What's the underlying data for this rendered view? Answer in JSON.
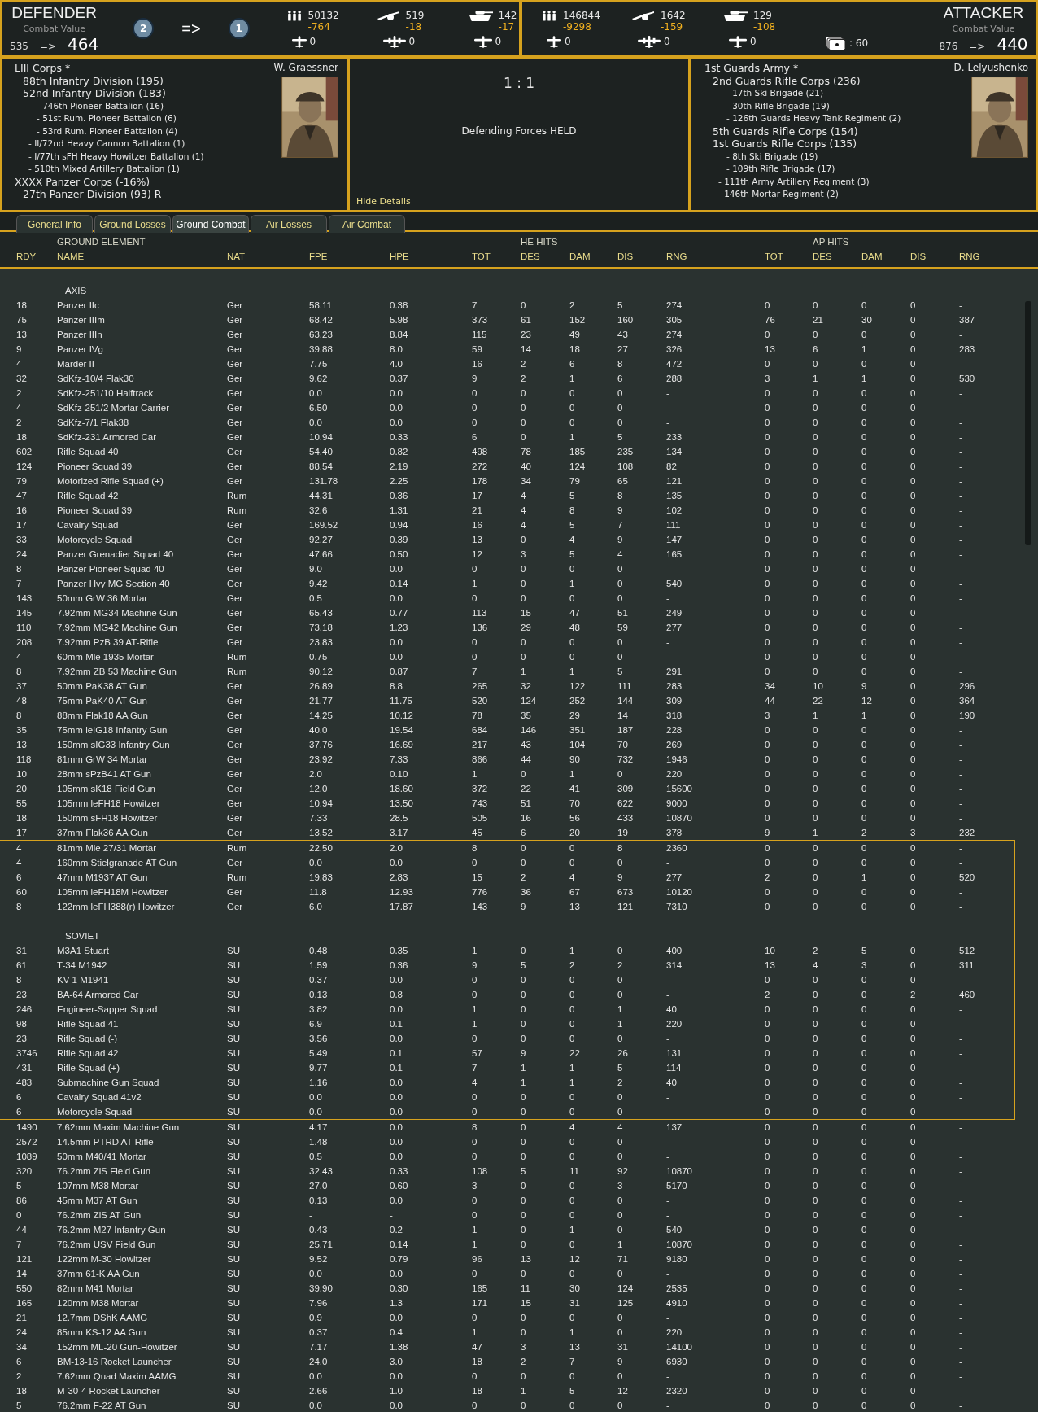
{
  "defender": {
    "title": "DEFENDER",
    "cv_label": "Combat Value",
    "cv_before": "535",
    "cv_arrow": "=>",
    "cv_after": "464",
    "markers": [
      "2",
      "1"
    ],
    "marker_arrow": "=>",
    "stats": [
      {
        "kind": "infantry",
        "value": "50132",
        "delta": "-764"
      },
      {
        "kind": "gun",
        "value": "519",
        "delta": "-18"
      },
      {
        "kind": "tank",
        "value": "142",
        "delta": "-17"
      }
    ],
    "air": [
      {
        "kind": "fighter",
        "value": "0"
      },
      {
        "kind": "bomber",
        "value": "0"
      },
      {
        "kind": "transport",
        "value": "0"
      }
    ]
  },
  "attacker": {
    "title": "ATTACKER",
    "cv_label": "Combat Value",
    "cv_before": "876",
    "cv_arrow": "=>",
    "cv_after": "440",
    "cards": ": 60",
    "stats": [
      {
        "kind": "infantry",
        "value": "146844",
        "delta": "-9298"
      },
      {
        "kind": "gun",
        "value": "1642",
        "delta": "-159"
      },
      {
        "kind": "tank",
        "value": "129",
        "delta": "-108"
      }
    ],
    "air": [
      {
        "kind": "fighter",
        "value": "0"
      },
      {
        "kind": "bomber",
        "value": "0"
      },
      {
        "kind": "transport",
        "value": "0"
      }
    ]
  },
  "defender_oob": {
    "leader": "W. Graessner",
    "units": [
      {
        "label": "LIII Corps *",
        "kind": "formation",
        "children": [
          {
            "label": "88th Infantry Division (195)",
            "kind": "formation"
          },
          {
            "label": "52nd Infantry Division (183)",
            "kind": "formation",
            "children": [
              {
                "label": "- 746th Pioneer Battalion (16)",
                "kind": "attachment"
              },
              {
                "label": "- 51st Rum. Pioneer Battalion (6)",
                "kind": "attachment"
              },
              {
                "label": "- 53rd Rum. Pioneer Battalion (4)",
                "kind": "attachment"
              }
            ]
          },
          {
            "label": "- II/72nd Heavy Cannon Battalion (1)",
            "kind": "attachment"
          },
          {
            "label": "- I/77th sFH Heavy Howitzer Battalion (1)",
            "kind": "attachment"
          },
          {
            "label": "- 510th Mixed Artillery Battalion (1)",
            "kind": "attachment"
          }
        ]
      },
      {
        "label": "XXXX Panzer Corps (-16%)",
        "kind": "formation",
        "children": [
          {
            "label": "27th Panzer Division (93)  R",
            "kind": "formation"
          }
        ]
      }
    ]
  },
  "result": {
    "odds": "1 : 1",
    "outcome": "Defending Forces HELD",
    "hide_link": "Hide Details"
  },
  "attacker_oob": {
    "leader": "D. Lelyushenko",
    "units": [
      {
        "label": "1st Guards Army *",
        "kind": "formation",
        "children": [
          {
            "label": "2nd Guards Rifle Corps (236)",
            "kind": "formation",
            "children": [
              {
                "label": "- 17th Ski Brigade (21)",
                "kind": "attachment"
              },
              {
                "label": "- 30th Rifle Brigade (19)",
                "kind": "attachment"
              },
              {
                "label": "- 126th Guards Heavy Tank Regiment (2)",
                "kind": "attachment"
              }
            ]
          },
          {
            "label": "5th Guards Rifle Corps (154)",
            "kind": "formation"
          },
          {
            "label": "1st Guards Rifle Corps (135)",
            "kind": "formation",
            "children": [
              {
                "label": "- 8th Ski Brigade (19)",
                "kind": "attachment"
              },
              {
                "label": "- 109th Rifle Brigade (17)",
                "kind": "attachment"
              }
            ]
          },
          {
            "label": "- 111th Army Artillery Regiment (3)",
            "kind": "attachment"
          },
          {
            "label": "- 146th Mortar Regiment (2)",
            "kind": "attachment"
          }
        ]
      }
    ]
  },
  "tabs": [
    {
      "label": "General Info",
      "selected": false
    },
    {
      "label": "Ground Losses",
      "selected": false
    },
    {
      "label": "Ground Combat",
      "selected": true
    },
    {
      "label": "Air Losses",
      "selected": false
    },
    {
      "label": "Air Combat",
      "selected": false
    }
  ],
  "table": {
    "group_headers": [
      "GROUND ELEMENT",
      "HE HITS",
      "AP HITS"
    ],
    "columns": [
      "RDY",
      "NAME",
      "NAT",
      "FPE",
      "HPE",
      "TOT",
      "DES",
      "DAM",
      "DIS",
      "RNG",
      "TOT",
      "DES",
      "DAM",
      "DIS",
      "RNG"
    ],
    "blocks": [
      {
        "framed": false,
        "rows": [
          {
            "kind": "blank"
          },
          {
            "kind": "section",
            "label": "AXIS"
          },
          {
            "kind": "unit",
            "cells": [
              "18",
              "Panzer IIc",
              "Ger",
              "58.11",
              "0.38",
              "7",
              "0",
              "2",
              "5",
              "274",
              "0",
              "0",
              "0",
              "0",
              "-"
            ]
          },
          {
            "kind": "unit",
            "cells": [
              "75",
              "Panzer IIIm",
              "Ger",
              "68.42",
              "5.98",
              "373",
              "61",
              "152",
              "160",
              "305",
              "76",
              "21",
              "30",
              "0",
              "387"
            ]
          },
          {
            "kind": "unit",
            "cells": [
              "13",
              "Panzer IIIn",
              "Ger",
              "63.23",
              "8.84",
              "115",
              "23",
              "49",
              "43",
              "274",
              "0",
              "0",
              "0",
              "0",
              "-"
            ]
          },
          {
            "kind": "unit",
            "cells": [
              "9",
              "Panzer IVg",
              "Ger",
              "39.88",
              "8.0",
              "59",
              "14",
              "18",
              "27",
              "326",
              "13",
              "6",
              "1",
              "0",
              "283"
            ]
          },
          {
            "kind": "unit",
            "cells": [
              "4",
              "Marder II",
              "Ger",
              "7.75",
              "4.0",
              "16",
              "2",
              "6",
              "8",
              "472",
              "0",
              "0",
              "0",
              "0",
              "-"
            ]
          },
          {
            "kind": "unit",
            "cells": [
              "32",
              "SdKfz-10/4 Flak30",
              "Ger",
              "9.62",
              "0.37",
              "9",
              "2",
              "1",
              "6",
              "288",
              "3",
              "1",
              "1",
              "0",
              "530"
            ]
          },
          {
            "kind": "unit",
            "cells": [
              "2",
              "SdKfz-251/10 Halftrack",
              "Ger",
              "0.0",
              "0.0",
              "0",
              "0",
              "0",
              "0",
              "-",
              "0",
              "0",
              "0",
              "0",
              "-"
            ]
          },
          {
            "kind": "unit",
            "cells": [
              "4",
              "SdKfz-251/2 Mortar Carrier",
              "Ger",
              "6.50",
              "0.0",
              "0",
              "0",
              "0",
              "0",
              "-",
              "0",
              "0",
              "0",
              "0",
              "-"
            ]
          },
          {
            "kind": "unit",
            "cells": [
              "2",
              "SdKfz-7/1 Flak38",
              "Ger",
              "0.0",
              "0.0",
              "0",
              "0",
              "0",
              "0",
              "-",
              "0",
              "0",
              "0",
              "0",
              "-"
            ]
          },
          {
            "kind": "unit",
            "cells": [
              "18",
              "SdKfz-231 Armored Car",
              "Ger",
              "10.94",
              "0.33",
              "6",
              "0",
              "1",
              "5",
              "233",
              "0",
              "0",
              "0",
              "0",
              "-"
            ]
          },
          {
            "kind": "unit",
            "cells": [
              "602",
              "Rifle Squad 40",
              "Ger",
              "54.40",
              "0.82",
              "498",
              "78",
              "185",
              "235",
              "134",
              "0",
              "0",
              "0",
              "0",
              "-"
            ]
          },
          {
            "kind": "unit",
            "cells": [
              "124",
              "Pioneer Squad 39",
              "Ger",
              "88.54",
              "2.19",
              "272",
              "40",
              "124",
              "108",
              "82",
              "0",
              "0",
              "0",
              "0",
              "-"
            ]
          },
          {
            "kind": "unit",
            "cells": [
              "79",
              "Motorized Rifle Squad (+)",
              "Ger",
              "131.78",
              "2.25",
              "178",
              "34",
              "79",
              "65",
              "121",
              "0",
              "0",
              "0",
              "0",
              "-"
            ]
          },
          {
            "kind": "unit",
            "cells": [
              "47",
              "Rifle Squad 42",
              "Rum",
              "44.31",
              "0.36",
              "17",
              "4",
              "5",
              "8",
              "135",
              "0",
              "0",
              "0",
              "0",
              "-"
            ]
          },
          {
            "kind": "unit",
            "cells": [
              "16",
              "Pioneer Squad 39",
              "Rum",
              "32.6",
              "1.31",
              "21",
              "4",
              "8",
              "9",
              "102",
              "0",
              "0",
              "0",
              "0",
              "-"
            ]
          },
          {
            "kind": "unit",
            "cells": [
              "17",
              "Cavalry Squad",
              "Ger",
              "169.52",
              "0.94",
              "16",
              "4",
              "5",
              "7",
              "111",
              "0",
              "0",
              "0",
              "0",
              "-"
            ]
          },
          {
            "kind": "unit",
            "cells": [
              "33",
              "Motorcycle Squad",
              "Ger",
              "92.27",
              "0.39",
              "13",
              "0",
              "4",
              "9",
              "147",
              "0",
              "0",
              "0",
              "0",
              "-"
            ]
          },
          {
            "kind": "unit",
            "cells": [
              "24",
              "Panzer Grenadier Squad 40",
              "Ger",
              "47.66",
              "0.50",
              "12",
              "3",
              "5",
              "4",
              "165",
              "0",
              "0",
              "0",
              "0",
              "-"
            ]
          },
          {
            "kind": "unit",
            "cells": [
              "8",
              "Panzer Pioneer Squad 40",
              "Ger",
              "9.0",
              "0.0",
              "0",
              "0",
              "0",
              "0",
              "-",
              "0",
              "0",
              "0",
              "0",
              "-"
            ]
          },
          {
            "kind": "unit",
            "cells": [
              "7",
              "Panzer Hvy MG Section 40",
              "Ger",
              "9.42",
              "0.14",
              "1",
              "0",
              "1",
              "0",
              "540",
              "0",
              "0",
              "0",
              "0",
              "-"
            ]
          },
          {
            "kind": "unit",
            "cells": [
              "143",
              "50mm GrW 36 Mortar",
              "Ger",
              "0.5",
              "0.0",
              "0",
              "0",
              "0",
              "0",
              "-",
              "0",
              "0",
              "0",
              "0",
              "-"
            ]
          },
          {
            "kind": "unit",
            "cells": [
              "145",
              "7.92mm MG34 Machine Gun",
              "Ger",
              "65.43",
              "0.77",
              "113",
              "15",
              "47",
              "51",
              "249",
              "0",
              "0",
              "0",
              "0",
              "-"
            ]
          },
          {
            "kind": "unit",
            "cells": [
              "110",
              "7.92mm MG42 Machine Gun",
              "Ger",
              "73.18",
              "1.23",
              "136",
              "29",
              "48",
              "59",
              "277",
              "0",
              "0",
              "0",
              "0",
              "-"
            ]
          },
          {
            "kind": "unit",
            "cells": [
              "208",
              "7.92mm PzB 39 AT-Rifle",
              "Ger",
              "23.83",
              "0.0",
              "0",
              "0",
              "0",
              "0",
              "-",
              "0",
              "0",
              "0",
              "0",
              "-"
            ]
          },
          {
            "kind": "unit",
            "cells": [
              "4",
              "60mm Mle 1935 Mortar",
              "Rum",
              "0.75",
              "0.0",
              "0",
              "0",
              "0",
              "0",
              "-",
              "0",
              "0",
              "0",
              "0",
              "-"
            ]
          },
          {
            "kind": "unit",
            "cells": [
              "8",
              "7.92mm ZB 53 Machine Gun",
              "Rum",
              "90.12",
              "0.87",
              "7",
              "1",
              "1",
              "5",
              "291",
              "0",
              "0",
              "0",
              "0",
              "-"
            ]
          },
          {
            "kind": "unit",
            "cells": [
              "37",
              "50mm PaK38 AT Gun",
              "Ger",
              "26.89",
              "8.8",
              "265",
              "32",
              "122",
              "111",
              "283",
              "34",
              "10",
              "9",
              "0",
              "296"
            ]
          },
          {
            "kind": "unit",
            "cells": [
              "48",
              "75mm PaK40 AT Gun",
              "Ger",
              "21.77",
              "11.75",
              "520",
              "124",
              "252",
              "144",
              "309",
              "44",
              "22",
              "12",
              "0",
              "364"
            ]
          },
          {
            "kind": "unit",
            "cells": [
              "8",
              "88mm Flak18 AA Gun",
              "Ger",
              "14.25",
              "10.12",
              "78",
              "35",
              "29",
              "14",
              "318",
              "3",
              "1",
              "1",
              "0",
              "190"
            ]
          },
          {
            "kind": "unit",
            "cells": [
              "35",
              "75mm leIG18 Infantry Gun",
              "Ger",
              "40.0",
              "19.54",
              "684",
              "146",
              "351",
              "187",
              "228",
              "0",
              "0",
              "0",
              "0",
              "-"
            ]
          },
          {
            "kind": "unit",
            "cells": [
              "13",
              "150mm sIG33 Infantry Gun",
              "Ger",
              "37.76",
              "16.69",
              "217",
              "43",
              "104",
              "70",
              "269",
              "0",
              "0",
              "0",
              "0",
              "-"
            ]
          },
          {
            "kind": "unit",
            "cells": [
              "118",
              "81mm GrW 34 Mortar",
              "Ger",
              "23.92",
              "7.33",
              "866",
              "44",
              "90",
              "732",
              "1946",
              "0",
              "0",
              "0",
              "0",
              "-"
            ]
          },
          {
            "kind": "unit",
            "cells": [
              "10",
              "28mm sPzB41 AT Gun",
              "Ger",
              "2.0",
              "0.10",
              "1",
              "0",
              "1",
              "0",
              "220",
              "0",
              "0",
              "0",
              "0",
              "-"
            ]
          },
          {
            "kind": "unit",
            "cells": [
              "20",
              "105mm sK18 Field Gun",
              "Ger",
              "12.0",
              "18.60",
              "372",
              "22",
              "41",
              "309",
              "15600",
              "0",
              "0",
              "0",
              "0",
              "-"
            ]
          },
          {
            "kind": "unit",
            "cells": [
              "55",
              "105mm leFH18 Howitzer",
              "Ger",
              "10.94",
              "13.50",
              "743",
              "51",
              "70",
              "622",
              "9000",
              "0",
              "0",
              "0",
              "0",
              "-"
            ]
          },
          {
            "kind": "unit",
            "cells": [
              "18",
              "150mm sFH18 Howitzer",
              "Ger",
              "7.33",
              "28.5",
              "505",
              "16",
              "56",
              "433",
              "10870",
              "0",
              "0",
              "0",
              "0",
              "-"
            ]
          },
          {
            "kind": "unit",
            "cells": [
              "17",
              "37mm Flak36 AA Gun",
              "Ger",
              "13.52",
              "3.17",
              "45",
              "6",
              "20",
              "19",
              "378",
              "9",
              "1",
              "2",
              "3",
              "232"
            ]
          }
        ]
      },
      {
        "framed": true,
        "rows": [
          {
            "kind": "unit",
            "cells": [
              "4",
              "81mm Mle 27/31 Mortar",
              "Rum",
              "22.50",
              "2.0",
              "8",
              "0",
              "0",
              "8",
              "2360",
              "0",
              "0",
              "0",
              "0",
              "-"
            ]
          },
          {
            "kind": "unit",
            "cells": [
              "4",
              "160mm Stielgranade AT Gun",
              "Ger",
              "0.0",
              "0.0",
              "0",
              "0",
              "0",
              "0",
              "-",
              "0",
              "0",
              "0",
              "0",
              "-"
            ]
          },
          {
            "kind": "unit",
            "cells": [
              "6",
              "47mm M1937 AT Gun",
              "Rum",
              "19.83",
              "2.83",
              "15",
              "2",
              "4",
              "9",
              "277",
              "2",
              "0",
              "1",
              "0",
              "520"
            ]
          },
          {
            "kind": "unit",
            "cells": [
              "60",
              "105mm leFH18M Howitzer",
              "Ger",
              "11.8",
              "12.93",
              "776",
              "36",
              "67",
              "673",
              "10120",
              "0",
              "0",
              "0",
              "0",
              "-"
            ]
          },
          {
            "kind": "unit",
            "cells": [
              "8",
              "122mm leFH388(r) Howitzer",
              "Ger",
              "6.0",
              "17.87",
              "143",
              "9",
              "13",
              "121",
              "7310",
              "0",
              "0",
              "0",
              "0",
              "-"
            ]
          },
          {
            "kind": "blank"
          },
          {
            "kind": "section",
            "label": "SOVIET"
          },
          {
            "kind": "unit",
            "cells": [
              "31",
              "M3A1 Stuart",
              "SU",
              "0.48",
              "0.35",
              "1",
              "0",
              "1",
              "0",
              "400",
              "10",
              "2",
              "5",
              "0",
              "512"
            ]
          },
          {
            "kind": "unit",
            "cells": [
              "61",
              "T-34 M1942",
              "SU",
              "1.59",
              "0.36",
              "9",
              "5",
              "2",
              "2",
              "314",
              "13",
              "4",
              "3",
              "0",
              "311"
            ]
          },
          {
            "kind": "unit",
            "cells": [
              "8",
              "KV-1 M1941",
              "SU",
              "0.37",
              "0.0",
              "0",
              "0",
              "0",
              "0",
              "-",
              "0",
              "0",
              "0",
              "0",
              "-"
            ]
          },
          {
            "kind": "unit",
            "cells": [
              "23",
              "BA-64 Armored Car",
              "SU",
              "0.13",
              "0.8",
              "0",
              "0",
              "0",
              "0",
              "-",
              "2",
              "0",
              "0",
              "2",
              "460"
            ]
          },
          {
            "kind": "unit",
            "cells": [
              "246",
              "Engineer-Sapper Squad",
              "SU",
              "3.82",
              "0.0",
              "1",
              "0",
              "0",
              "1",
              "40",
              "0",
              "0",
              "0",
              "0",
              "-"
            ]
          },
          {
            "kind": "unit",
            "cells": [
              "98",
              "Rifle Squad 41",
              "SU",
              "6.9",
              "0.1",
              "1",
              "0",
              "0",
              "1",
              "220",
              "0",
              "0",
              "0",
              "0",
              "-"
            ]
          },
          {
            "kind": "unit",
            "cells": [
              "23",
              "Rifle Squad (-)",
              "SU",
              "3.56",
              "0.0",
              "0",
              "0",
              "0",
              "0",
              "-",
              "0",
              "0",
              "0",
              "0",
              "-"
            ]
          },
          {
            "kind": "unit",
            "cells": [
              "3746",
              "Rifle Squad 42",
              "SU",
              "5.49",
              "0.1",
              "57",
              "9",
              "22",
              "26",
              "131",
              "0",
              "0",
              "0",
              "0",
              "-"
            ]
          },
          {
            "kind": "unit",
            "cells": [
              "431",
              "Rifle Squad (+)",
              "SU",
              "9.77",
              "0.1",
              "7",
              "1",
              "1",
              "5",
              "114",
              "0",
              "0",
              "0",
              "0",
              "-"
            ]
          },
          {
            "kind": "unit",
            "cells": [
              "483",
              "Submachine Gun Squad",
              "SU",
              "1.16",
              "0.0",
              "4",
              "1",
              "1",
              "2",
              "40",
              "0",
              "0",
              "0",
              "0",
              "-"
            ]
          },
          {
            "kind": "unit",
            "cells": [
              "6",
              "Cavalry Squad 41v2",
              "SU",
              "0.0",
              "0.0",
              "0",
              "0",
              "0",
              "0",
              "-",
              "0",
              "0",
              "0",
              "0",
              "-"
            ]
          },
          {
            "kind": "unit",
            "cells": [
              "6",
              "Motorcycle Squad",
              "SU",
              "0.0",
              "0.0",
              "0",
              "0",
              "0",
              "0",
              "-",
              "0",
              "0",
              "0",
              "0",
              "-"
            ]
          }
        ]
      },
      {
        "framed": false,
        "rows": [
          {
            "kind": "unit",
            "cells": [
              "1490",
              "7.62mm Maxim Machine Gun",
              "SU",
              "4.17",
              "0.0",
              "8",
              "0",
              "4",
              "4",
              "137",
              "0",
              "0",
              "0",
              "0",
              "-"
            ]
          },
          {
            "kind": "unit",
            "cells": [
              "2572",
              "14.5mm PTRD AT-Rifle",
              "SU",
              "1.48",
              "0.0",
              "0",
              "0",
              "0",
              "0",
              "-",
              "0",
              "0",
              "0",
              "0",
              "-"
            ]
          },
          {
            "kind": "unit",
            "cells": [
              "1089",
              "50mm M40/41 Mortar",
              "SU",
              "0.5",
              "0.0",
              "0",
              "0",
              "0",
              "0",
              "-",
              "0",
              "0",
              "0",
              "0",
              "-"
            ]
          },
          {
            "kind": "unit",
            "cells": [
              "320",
              "76.2mm ZiS Field Gun",
              "SU",
              "32.43",
              "0.33",
              "108",
              "5",
              "11",
              "92",
              "10870",
              "0",
              "0",
              "0",
              "0",
              "-"
            ]
          },
          {
            "kind": "unit",
            "cells": [
              "5",
              "107mm M38 Mortar",
              "SU",
              "27.0",
              "0.60",
              "3",
              "0",
              "0",
              "3",
              "5170",
              "0",
              "0",
              "0",
              "0",
              "-"
            ]
          },
          {
            "kind": "unit",
            "cells": [
              "86",
              "45mm M37 AT Gun",
              "SU",
              "0.13",
              "0.0",
              "0",
              "0",
              "0",
              "0",
              "-",
              "0",
              "0",
              "0",
              "0",
              "-"
            ]
          },
          {
            "kind": "unit",
            "cells": [
              "0",
              "76.2mm ZiS AT Gun",
              "SU",
              "-",
              "-",
              "0",
              "0",
              "0",
              "0",
              "-",
              "0",
              "0",
              "0",
              "0",
              "-"
            ]
          },
          {
            "kind": "unit",
            "cells": [
              "44",
              "76.2mm M27 Infantry Gun",
              "SU",
              "0.43",
              "0.2",
              "1",
              "0",
              "1",
              "0",
              "540",
              "0",
              "0",
              "0",
              "0",
              "-"
            ]
          },
          {
            "kind": "unit",
            "cells": [
              "7",
              "76.2mm USV Field Gun",
              "SU",
              "25.71",
              "0.14",
              "1",
              "0",
              "0",
              "1",
              "10870",
              "0",
              "0",
              "0",
              "0",
              "-"
            ]
          },
          {
            "kind": "unit",
            "cells": [
              "121",
              "122mm M-30 Howitzer",
              "SU",
              "9.52",
              "0.79",
              "96",
              "13",
              "12",
              "71",
              "9180",
              "0",
              "0",
              "0",
              "0",
              "-"
            ]
          },
          {
            "kind": "unit",
            "cells": [
              "14",
              "37mm 61-K AA Gun",
              "SU",
              "0.0",
              "0.0",
              "0",
              "0",
              "0",
              "0",
              "-",
              "0",
              "0",
              "0",
              "0",
              "-"
            ]
          },
          {
            "kind": "unit",
            "cells": [
              "550",
              "82mm M41 Mortar",
              "SU",
              "39.90",
              "0.30",
              "165",
              "11",
              "30",
              "124",
              "2535",
              "0",
              "0",
              "0",
              "0",
              "-"
            ]
          },
          {
            "kind": "unit",
            "cells": [
              "165",
              "120mm M38 Mortar",
              "SU",
              "7.96",
              "1.3",
              "171",
              "15",
              "31",
              "125",
              "4910",
              "0",
              "0",
              "0",
              "0",
              "-"
            ]
          },
          {
            "kind": "unit",
            "cells": [
              "21",
              "12.7mm DShK AAMG",
              "SU",
              "0.9",
              "0.0",
              "0",
              "0",
              "0",
              "0",
              "-",
              "0",
              "0",
              "0",
              "0",
              "-"
            ]
          },
          {
            "kind": "unit",
            "cells": [
              "24",
              "85mm KS-12 AA Gun",
              "SU",
              "0.37",
              "0.4",
              "1",
              "0",
              "1",
              "0",
              "220",
              "0",
              "0",
              "0",
              "0",
              "-"
            ]
          },
          {
            "kind": "unit",
            "cells": [
              "34",
              "152mm ML-20 Gun-Howitzer",
              "SU",
              "7.17",
              "1.38",
              "47",
              "3",
              "13",
              "31",
              "14100",
              "0",
              "0",
              "0",
              "0",
              "-"
            ]
          },
          {
            "kind": "unit",
            "cells": [
              "6",
              "BM-13-16 Rocket Launcher",
              "SU",
              "24.0",
              "3.0",
              "18",
              "2",
              "7",
              "9",
              "6930",
              "0",
              "0",
              "0",
              "0",
              "-"
            ]
          },
          {
            "kind": "unit",
            "cells": [
              "2",
              "7.62mm Quad Maxim AAMG",
              "SU",
              "0.0",
              "0.0",
              "0",
              "0",
              "0",
              "0",
              "-",
              "0",
              "0",
              "0",
              "0",
              "-"
            ]
          },
          {
            "kind": "unit",
            "cells": [
              "18",
              "M-30-4 Rocket Launcher",
              "SU",
              "2.66",
              "1.0",
              "18",
              "1",
              "5",
              "12",
              "2320",
              "0",
              "0",
              "0",
              "0",
              "-"
            ]
          },
          {
            "kind": "unit",
            "cells": [
              "5",
              "76.2mm F-22 AT Gun",
              "SU",
              "0.0",
              "0.0",
              "0",
              "0",
              "0",
              "0",
              "-",
              "0",
              "0",
              "0",
              "0",
              "-"
            ]
          }
        ]
      }
    ]
  }
}
